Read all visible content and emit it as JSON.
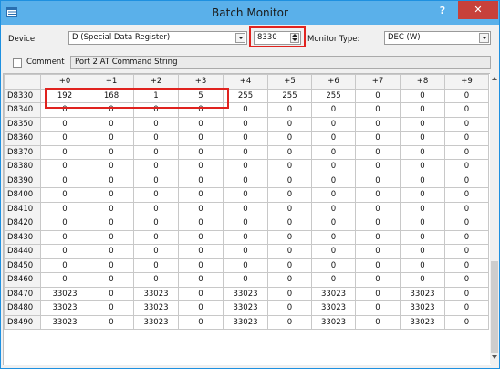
{
  "window": {
    "title": "Batch Monitor",
    "help_label": "?",
    "close_label": "✕"
  },
  "toolbar": {
    "device_label": "Device:",
    "device_value": "D (Special Data Register)",
    "address_value": "8330",
    "monitor_type_label": "Monitor Type:",
    "monitor_type_value": "DEC (W)",
    "comment_checkbox_label": "Comment",
    "comment_text": "Port 2 AT Command String"
  },
  "grid": {
    "columns": [
      "+0",
      "+1",
      "+2",
      "+3",
      "+4",
      "+5",
      "+6",
      "+7",
      "+8",
      "+9"
    ],
    "rows": [
      {
        "label": "D8330",
        "values": [
          "192",
          "168",
          "1",
          "5",
          "255",
          "255",
          "255",
          "0",
          "0",
          "0"
        ]
      },
      {
        "label": "D8340",
        "values": [
          "0",
          "0",
          "0",
          "0",
          "0",
          "0",
          "0",
          "0",
          "0",
          "0"
        ]
      },
      {
        "label": "D8350",
        "values": [
          "0",
          "0",
          "0",
          "0",
          "0",
          "0",
          "0",
          "0",
          "0",
          "0"
        ]
      },
      {
        "label": "D8360",
        "values": [
          "0",
          "0",
          "0",
          "0",
          "0",
          "0",
          "0",
          "0",
          "0",
          "0"
        ]
      },
      {
        "label": "D8370",
        "values": [
          "0",
          "0",
          "0",
          "0",
          "0",
          "0",
          "0",
          "0",
          "0",
          "0"
        ]
      },
      {
        "label": "D8380",
        "values": [
          "0",
          "0",
          "0",
          "0",
          "0",
          "0",
          "0",
          "0",
          "0",
          "0"
        ]
      },
      {
        "label": "D8390",
        "values": [
          "0",
          "0",
          "0",
          "0",
          "0",
          "0",
          "0",
          "0",
          "0",
          "0"
        ]
      },
      {
        "label": "D8400",
        "values": [
          "0",
          "0",
          "0",
          "0",
          "0",
          "0",
          "0",
          "0",
          "0",
          "0"
        ]
      },
      {
        "label": "D8410",
        "values": [
          "0",
          "0",
          "0",
          "0",
          "0",
          "0",
          "0",
          "0",
          "0",
          "0"
        ]
      },
      {
        "label": "D8420",
        "values": [
          "0",
          "0",
          "0",
          "0",
          "0",
          "0",
          "0",
          "0",
          "0",
          "0"
        ]
      },
      {
        "label": "D8430",
        "values": [
          "0",
          "0",
          "0",
          "0",
          "0",
          "0",
          "0",
          "0",
          "0",
          "0"
        ]
      },
      {
        "label": "D8440",
        "values": [
          "0",
          "0",
          "0",
          "0",
          "0",
          "0",
          "0",
          "0",
          "0",
          "0"
        ]
      },
      {
        "label": "D8450",
        "values": [
          "0",
          "0",
          "0",
          "0",
          "0",
          "0",
          "0",
          "0",
          "0",
          "0"
        ]
      },
      {
        "label": "D8460",
        "values": [
          "0",
          "0",
          "0",
          "0",
          "0",
          "0",
          "0",
          "0",
          "0",
          "0"
        ]
      },
      {
        "label": "D8470",
        "values": [
          "33023",
          "0",
          "33023",
          "0",
          "33023",
          "0",
          "33023",
          "0",
          "33023",
          "0"
        ]
      },
      {
        "label": "D8480",
        "values": [
          "33023",
          "0",
          "33023",
          "0",
          "33023",
          "0",
          "33023",
          "0",
          "33023",
          "0"
        ]
      },
      {
        "label": "D8490",
        "values": [
          "33023",
          "0",
          "33023",
          "0",
          "33023",
          "0",
          "33023",
          "0",
          "33023",
          "0"
        ]
      }
    ]
  },
  "colors": {
    "titlebar": "#5ab0ea",
    "close_button": "#c7413b",
    "highlight_box": "#e0231f"
  }
}
